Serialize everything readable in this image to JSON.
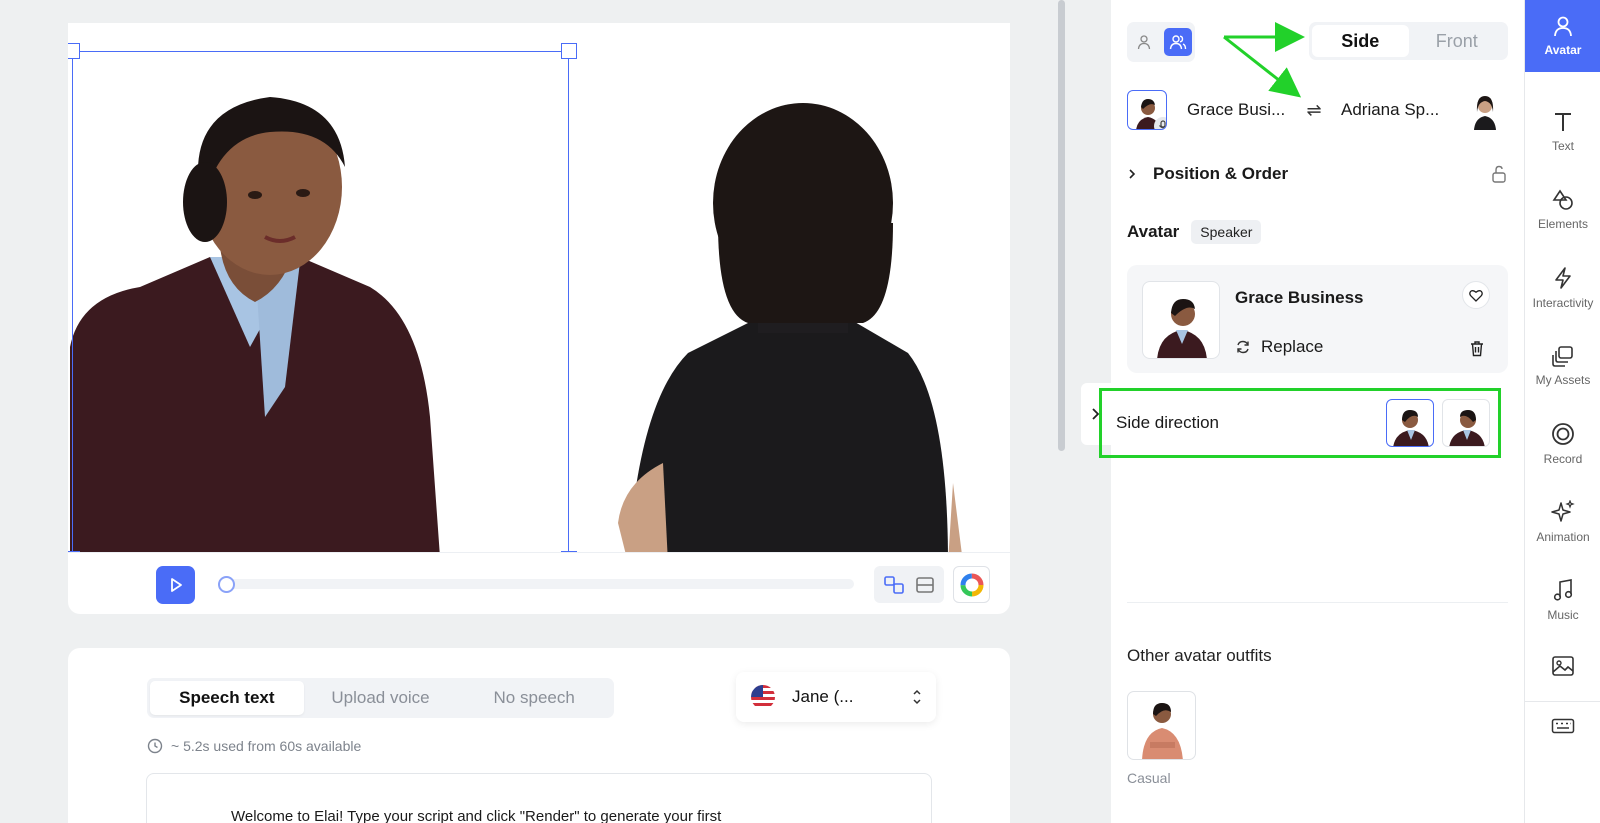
{
  "canvas": {
    "avatars": [
      "Grace Business",
      "Adriana Sp..."
    ]
  },
  "player": {
    "play_label": "Play"
  },
  "script": {
    "tabs": [
      "Speech text",
      "Upload voice",
      "No speech"
    ],
    "active_tab": "Speech text",
    "voice": "Jane (...",
    "usage": "~ 5.2s used from 60s available",
    "text": "Welcome to Elai! Type your script and click \"Render\" to generate your first"
  },
  "panel": {
    "view_tabs": [
      "Side",
      "Front"
    ],
    "active_view": "Side",
    "pair": {
      "left_name": "Grace Busi...",
      "right_name": "Adriana Sp..."
    },
    "position_order": "Position & Order",
    "avatar_title": "Avatar",
    "speaker_chip": "Speaker",
    "avatar_card": {
      "name": "Grace Business",
      "replace": "Replace"
    },
    "side_direction": "Side direction",
    "other_outfits": "Other avatar outfits",
    "outfit": "Casual"
  },
  "rail": {
    "items": [
      {
        "label": "Avatar",
        "icon": "person-icon"
      },
      {
        "label": "Text",
        "icon": "text-icon"
      },
      {
        "label": "Elements",
        "icon": "shapes-icon"
      },
      {
        "label": "Interactivity",
        "icon": "bolt-icon"
      },
      {
        "label": "My Assets",
        "icon": "assets-icon"
      },
      {
        "label": "Record",
        "icon": "record-icon"
      },
      {
        "label": "Animation",
        "icon": "sparkle-icon"
      },
      {
        "label": "Music",
        "icon": "music-icon"
      }
    ]
  },
  "colors": {
    "accent": "#4a6cf7",
    "highlight": "#22d12a",
    "jacket": "#3d1a1f"
  }
}
